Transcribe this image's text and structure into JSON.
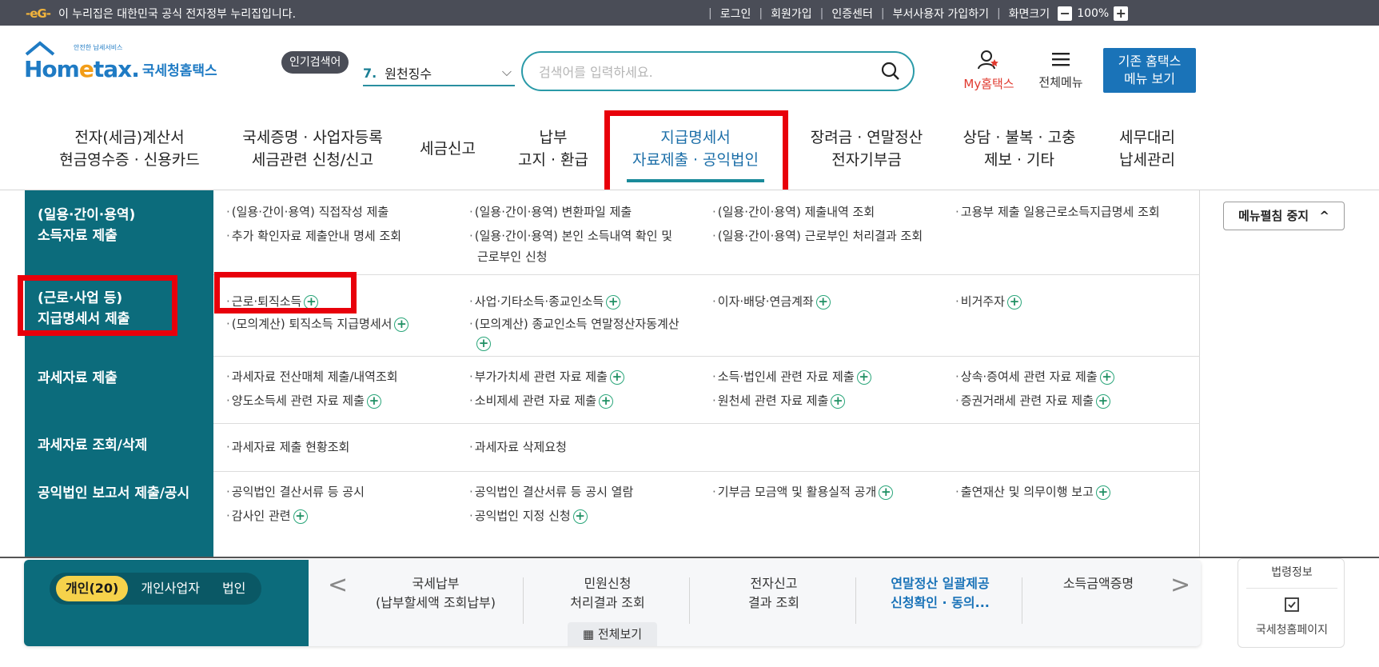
{
  "topbar": {
    "gov_logo": "-eG-",
    "gov_text": "이 누리집은 대한민국 공식 전자정부 누리집입니다.",
    "links": [
      "로그인",
      "회원가입",
      "인증센터",
      "부서사용자 가입하기",
      "화면크기"
    ],
    "zoom": "100%",
    "zoom_minus": "−",
    "zoom_plus": "+"
  },
  "header": {
    "logo_small": "안전한 납세서비스",
    "logo_hom": "Hom",
    "logo_e": "e",
    "logo_tax": "tax.",
    "logo_kr": "국세청홈택스",
    "popular_label": "인기검색어",
    "popular_rank": "7.",
    "popular_term": "원천징수",
    "search_placeholder": "검색어를 입력하세요.",
    "my_hometax": "My홈택스",
    "all_menu": "전체메뉴",
    "old_home_line1": "기존 홈택스",
    "old_home_line2": "메뉴 보기"
  },
  "gnb": [
    {
      "l1": "전자(세금)계산서",
      "l2": "현금영수증 · 신용카드"
    },
    {
      "l1": "국세증명 · 사업자등록",
      "l2": "세금관련 신청/신고"
    },
    {
      "l1": "세금신고",
      "l2": ""
    },
    {
      "l1": "납부",
      "l2": "고지 · 환급"
    },
    {
      "l1": "지급명세서",
      "l2": "자료제출 · 공익법인"
    },
    {
      "l1": "장려금 · 연말정산",
      "l2": "전자기부금"
    },
    {
      "l1": "상담 · 불복 · 고충",
      "l2": "제보 · 기타"
    },
    {
      "l1": "세무대리",
      "l2": "납세관리"
    }
  ],
  "categories": [
    {
      "l1": "(일용·간이·용역)",
      "l2": "소득자료 제출"
    },
    {
      "l1": "(근로·사업 등)",
      "l2": "지급명세서 제출"
    },
    {
      "l1": "과세자료 제출",
      "l2": ""
    },
    {
      "l1": "과세자료 조회/삭제",
      "l2": ""
    },
    {
      "l1": "공익법인 보고서 제출/공시",
      "l2": ""
    }
  ],
  "menu": {
    "r0c0a": "(일용·간이·용역) 직접작성 제출",
    "r0c0b": "추가 확인자료 제출안내 명세 조회",
    "r0c1a": "(일용·간이·용역) 변환파일 제출",
    "r0c1b": "(일용·간이·용역) 본인 소득내역 확인 및",
    "r0c1c": "근로부인 신청",
    "r0c2a": "(일용·간이·용역) 제출내역 조회",
    "r0c2b": "(일용·간이·용역) 근로부인 처리결과 조회",
    "r0c3a": "고용부 제출 일용근로소득지급명세 조회",
    "r1c0a": "근로·퇴직소득",
    "r1c0b": "(모의계산) 퇴직소득 지급명세서",
    "r1c1a": "사업·기타소득·종교인소득",
    "r1c1b": "(모의계산) 종교인소득 연말정산자동계산",
    "r1c2a": "이자·배당·연금계좌",
    "r1c3a": "비거주자",
    "r2c0a": "과세자료 전산매체 제출/내역조회",
    "r2c0b": "양도소득세 관련 자료 제출",
    "r2c1a": "부가가치세 관련 자료 제출",
    "r2c1b": "소비제세 관련 자료 제출",
    "r2c2a": "소득·법인세 관련 자료 제출",
    "r2c2b": "원천세 관련 자료 제출",
    "r2c3a": "상속·증여세 관련 자료 제출",
    "r2c3b": "증권거래세 관련 자료 제출",
    "r3c0a": "과세자료 제출 현황조회",
    "r3c1a": "과세자료 삭제요청",
    "r4c0a": "공익법인 결산서류 등 공시",
    "r4c0b": "감사인 관련",
    "r4c1a": "공익법인 결산서류 등 공시 열람",
    "r4c1b": "공익법인 지정 신청",
    "r4c2a": "기부금 모금액 및 활용실적 공개",
    "r4c3a": "출연재산 및 의무이행 보고"
  },
  "menu_stop": "메뉴펼침 중지",
  "bottom": {
    "tabs": [
      "개인(20)",
      "개인사업자",
      "법인"
    ],
    "quick": [
      {
        "l1": "국세납부",
        "l2": "(납부할세액 조회납부)"
      },
      {
        "l1": "민원신청",
        "l2": "처리결과 조회"
      },
      {
        "l1": "전자신고",
        "l2": "결과 조회"
      },
      {
        "l1": "연말정산 일괄제공",
        "l2": "신청확인 · 동의..."
      },
      {
        "l1": "소득금액증명",
        "l2": ""
      }
    ],
    "all_view": "전체보기",
    "right_1": "법령정보",
    "right_2": "국세청홈페이지"
  },
  "colors": {
    "teal": "#0c6c7c",
    "highlight_red": "#e8000b",
    "brand_blue": "#1a73b8",
    "tab_yellow": "#f6d24b"
  }
}
